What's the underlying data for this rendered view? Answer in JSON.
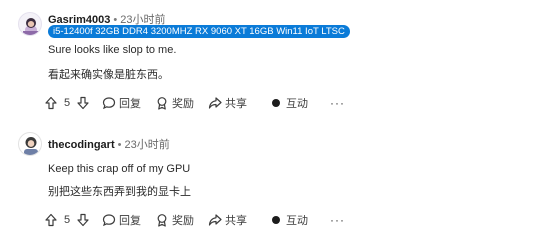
{
  "comments": [
    {
      "author": "Gasrim4003",
      "separator": "•",
      "time": "23小时前",
      "flair": "i5-12400f 32GB DDR4 3200MHZ RX 9060 XT 16GB Win11 IoT LTSC",
      "lines": [
        "Sure looks like slop to me.",
        "看起来确实像是脏东西。"
      ],
      "score": "5",
      "actions": {
        "reply": "回复",
        "award": "奖励",
        "share": "共享",
        "interact": "互动",
        "more": "···"
      }
    },
    {
      "author": "thecodingart",
      "separator": "•",
      "time": "23小时前",
      "lines": [
        "Keep this crap off of my GPU",
        "别把这些东西弄到我的显卡上"
      ],
      "score": "5",
      "actions": {
        "reply": "回复",
        "award": "奖励",
        "share": "共享",
        "interact": "互动",
        "more": "···"
      }
    }
  ],
  "icons": {
    "upvote": "upvote-arrow-icon",
    "downvote": "downvote-arrow-icon",
    "reply": "speech-bubble-icon",
    "award": "award-ribbon-icon",
    "share": "share-arrow-icon",
    "interact": "filled-circle-icon"
  },
  "colors": {
    "flair_bg": "#0a7bd8",
    "flair_text": "#ffffff",
    "text": "#1c1c1c",
    "muted": "#6a6a6a"
  }
}
